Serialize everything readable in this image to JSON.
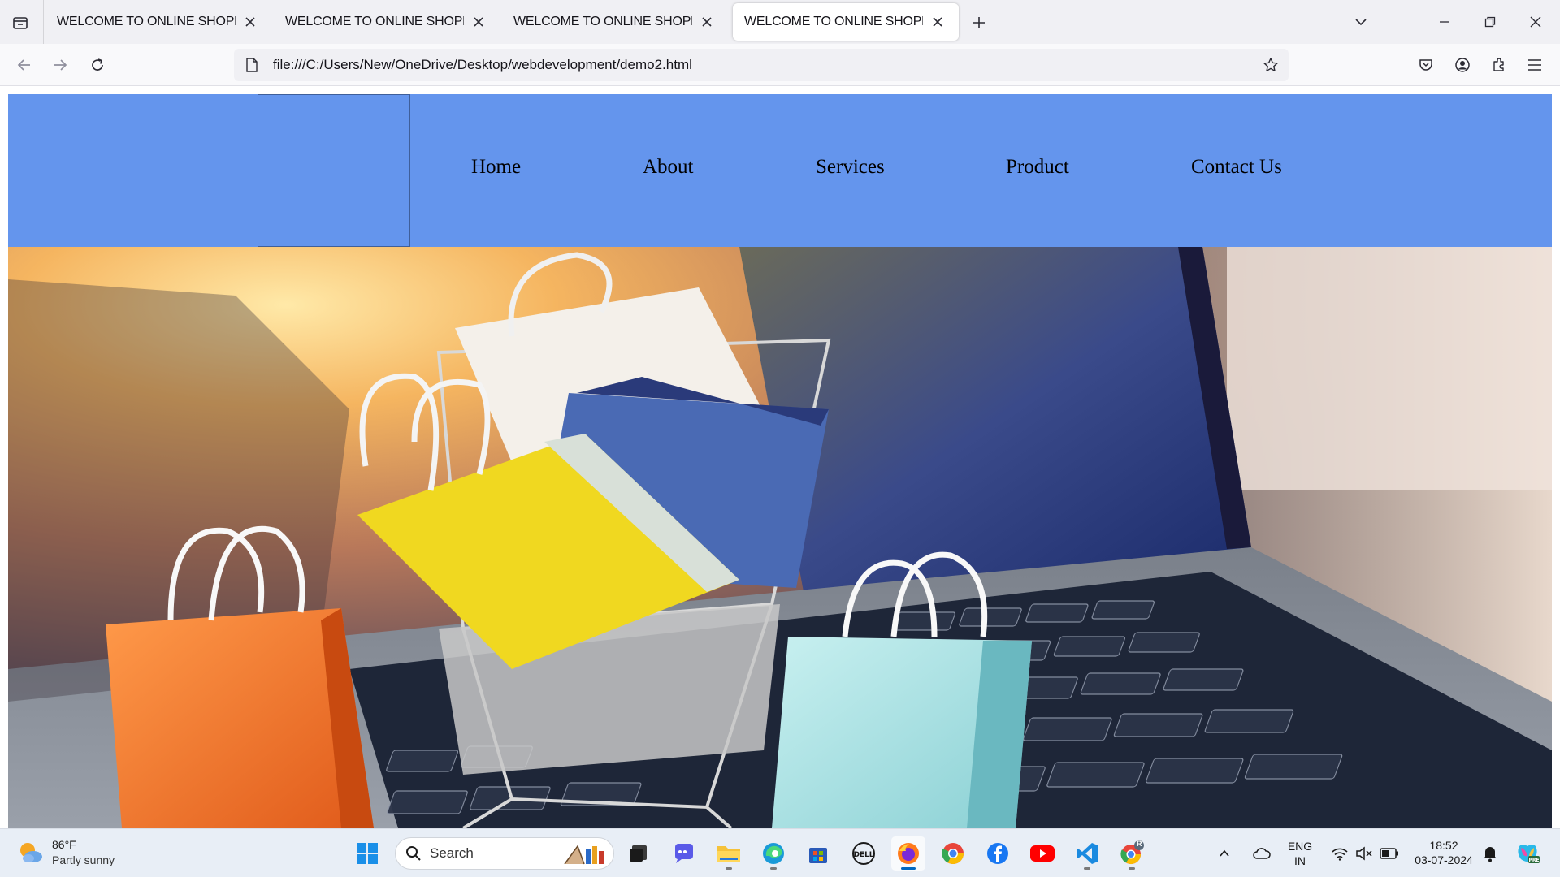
{
  "browser": {
    "tabs": [
      {
        "title": "WELCOME TO ONLINE SHOPPING"
      },
      {
        "title": "WELCOME TO ONLINE SHOPPING"
      },
      {
        "title": "WELCOME TO ONLINE SHOPPING"
      },
      {
        "title": "WELCOME TO ONLINE SHOPPING",
        "active": true
      }
    ],
    "url": "file:///C:/Users/New/OneDrive/Desktop/webdevelopment/demo2.html"
  },
  "site": {
    "header_color": "#6495ed",
    "nav": [
      {
        "label": "Home"
      },
      {
        "label": "About"
      },
      {
        "label": "Services"
      },
      {
        "label": "Product"
      },
      {
        "label": "Contact Us"
      }
    ],
    "hero_image": "shopping-bags-cart-on-laptop-keyboard"
  },
  "taskbar": {
    "weather_temp": "86°F",
    "weather_condition": "Partly sunny",
    "search_label": "Search",
    "language_line1": "ENG",
    "language_line2": "IN",
    "time": "18:52",
    "date": "03-07-2024",
    "chrome_badge": "R"
  }
}
